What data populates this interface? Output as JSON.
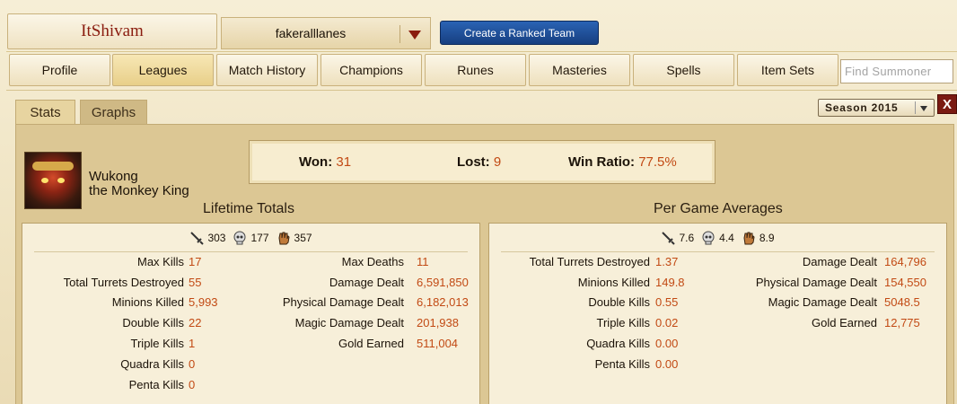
{
  "header": {
    "player_name": "ItShivam",
    "summoner_select": "fakeralllanes",
    "ranked_team_button": "Create a Ranked Team"
  },
  "nav": {
    "tabs": [
      "Profile",
      "Leagues",
      "Match History",
      "Champions",
      "Runes",
      "Masteries",
      "Spells",
      "Item Sets"
    ],
    "active": "Leagues",
    "search_placeholder": "Find Summoner"
  },
  "panel": {
    "sub_tabs": [
      "Stats",
      "Graphs"
    ],
    "active_sub_tab": "Stats",
    "season": "Season 2015",
    "close_label": "X"
  },
  "champion": {
    "name": "Wukong",
    "title": "the Monkey King"
  },
  "record": {
    "won_label": "Won:",
    "won": "31",
    "lost_label": "Lost:",
    "lost": "9",
    "ratio_label": "Win Ratio:",
    "ratio": "77.5%"
  },
  "lifetime": {
    "title": "Lifetime Totals",
    "kills": "303",
    "deaths": "177",
    "assists": "357",
    "left": [
      {
        "label": "Max Kills",
        "value": "17"
      },
      {
        "label": "Total Turrets Destroyed",
        "value": "55"
      },
      {
        "label": "Minions Killed",
        "value": "5,993"
      },
      {
        "label": "Double Kills",
        "value": "22"
      },
      {
        "label": "Triple Kills",
        "value": "1"
      },
      {
        "label": "Quadra Kills",
        "value": "0"
      },
      {
        "label": "Penta Kills",
        "value": "0"
      }
    ],
    "right": [
      {
        "label": "Max Deaths",
        "value": "11"
      },
      {
        "label": "Damage Dealt",
        "value": "6,591,850"
      },
      {
        "label": "Physical Damage Dealt",
        "value": "6,182,013"
      },
      {
        "label": "Magic Damage Dealt",
        "value": "201,938"
      },
      {
        "label": "Gold Earned",
        "value": "511,004"
      }
    ]
  },
  "averages": {
    "title": "Per Game Averages",
    "kills": "7.6",
    "deaths": "4.4",
    "assists": "8.9",
    "left": [
      {
        "label": "Total Turrets Destroyed",
        "value": "1.37"
      },
      {
        "label": "Minions Killed",
        "value": "149.8"
      },
      {
        "label": "Double Kills",
        "value": "0.55"
      },
      {
        "label": "Triple Kills",
        "value": "0.02"
      },
      {
        "label": "Quadra Kills",
        "value": "0.00"
      },
      {
        "label": "Penta Kills",
        "value": "0.00"
      }
    ],
    "right": [
      {
        "label": "Damage Dealt",
        "value": "164,796"
      },
      {
        "label": "Physical Damage Dealt",
        "value": "154,550"
      },
      {
        "label": "Magic Damage Dealt",
        "value": "5048.5"
      },
      {
        "label": "Gold Earned",
        "value": "12,775"
      }
    ]
  },
  "colors": {
    "accent_value": "#c24a14",
    "player_name": "#8a1c0f",
    "ranked_button": "#1f4f9c"
  }
}
